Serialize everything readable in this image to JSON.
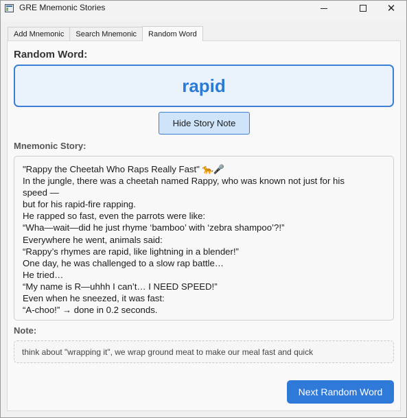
{
  "window": {
    "title": "GRE Mnemonic Stories",
    "minimize_icon": "minimize-icon",
    "maximize_icon": "maximize-icon",
    "close_icon": "close-icon"
  },
  "tabs": [
    {
      "label": "Add Mnemonic",
      "active": false
    },
    {
      "label": "Search Mnemonic",
      "active": false
    },
    {
      "label": "Random Word",
      "active": true
    }
  ],
  "random_word": {
    "heading": "Random Word:",
    "word": "rapid"
  },
  "buttons": {
    "hide_story_note": "Hide Story  Note",
    "next_random_word": "Next Random Word"
  },
  "story": {
    "heading": "Mnemonic Story:",
    "lines": [
      "\"Rappy the Cheetah Who Raps Really Fast\" 🐆🎤",
      "In the jungle, there was a cheetah named Rappy, who was known not just for his",
      "speed —",
      "but for his rapid-fire rapping.",
      "He rapped so fast, even the parrots were like:",
      "“Wha—wait—did he just rhyme ‘bamboo’ with ‘zebra shampoo’?!”",
      "Everywhere he went, animals said:",
      "“Rappy’s rhymes are rapid, like lightning in a blender!”",
      "One day, he was challenged to a slow rap battle…",
      "He tried…",
      "“My name is R—uhhh I can’t… I NEED SPEED!”",
      "Even when he sneezed, it was fast:",
      "“A-choo!” → done in 0.2 seconds."
    ]
  },
  "note": {
    "heading": "Note:",
    "text": "think about \"wrapping it\", we wrap ground meat to make our meal fast and quick"
  },
  "colors": {
    "accent": "#2f7ad8",
    "word_text": "#2a7ad6",
    "word_box_bg": "#eaf3fc"
  }
}
